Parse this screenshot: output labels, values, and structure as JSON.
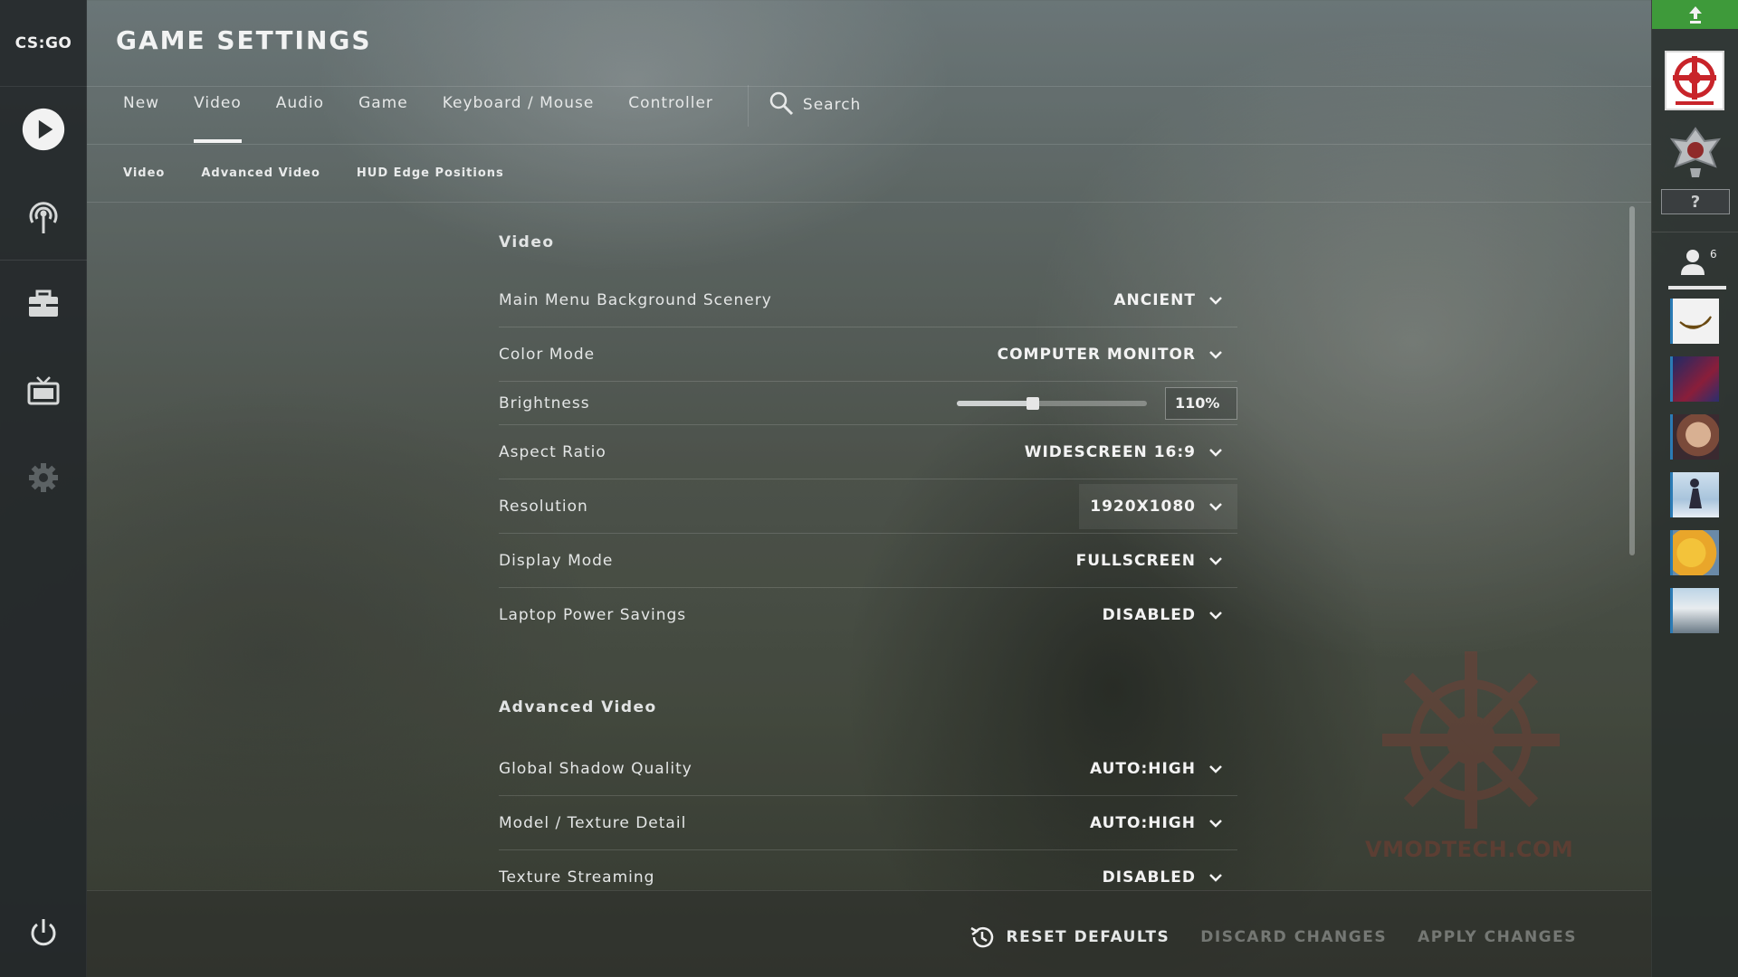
{
  "sidebar_left": {
    "logo_text": "CS:GO",
    "items": [
      {
        "name": "play-icon"
      },
      {
        "name": "broadcast-icon"
      },
      {
        "name": "inventory-icon"
      },
      {
        "name": "tv-icon"
      },
      {
        "name": "settings-gear-icon"
      },
      {
        "name": "power-icon"
      }
    ]
  },
  "header": {
    "title": "GAME SETTINGS",
    "tabs": [
      {
        "label": "New",
        "active": false
      },
      {
        "label": "Video",
        "active": true
      },
      {
        "label": "Audio",
        "active": false
      },
      {
        "label": "Game",
        "active": false
      },
      {
        "label": "Keyboard / Mouse",
        "active": false
      },
      {
        "label": "Controller",
        "active": false
      }
    ],
    "search_label": "Search",
    "subtabs": [
      "Video",
      "Advanced Video",
      "HUD Edge Positions"
    ]
  },
  "sections": {
    "video": {
      "title": "Video",
      "rows": [
        {
          "label": "Main Menu Background Scenery",
          "value": "ANCIENT"
        },
        {
          "label": "Color Mode",
          "value": "COMPUTER MONITOR"
        },
        {
          "label": "Brightness",
          "value": "110%",
          "level": 0.4
        },
        {
          "label": "Aspect Ratio",
          "value": "WIDESCREEN 16:9"
        },
        {
          "label": "Resolution",
          "value": "1920X1080"
        },
        {
          "label": "Display Mode",
          "value": "FULLSCREEN"
        },
        {
          "label": "Laptop Power Savings",
          "value": "DISABLED"
        }
      ]
    },
    "advanced": {
      "title": "Advanced Video",
      "rows": [
        {
          "label": "Global Shadow Quality",
          "value": "AUTO:HIGH"
        },
        {
          "label": "Model / Texture Detail",
          "value": "AUTO:HIGH"
        },
        {
          "label": "Texture Streaming",
          "value": "DISABLED"
        }
      ]
    }
  },
  "sidebar_right": {
    "friends_count": "6",
    "rank_help": "?"
  },
  "watermark_text": "VMODTECH.COM",
  "footer": {
    "reset_label": "RESET DEFAULTS",
    "discard_label": "DISCARD CHANGES",
    "apply_label": "APPLY CHANGES"
  }
}
